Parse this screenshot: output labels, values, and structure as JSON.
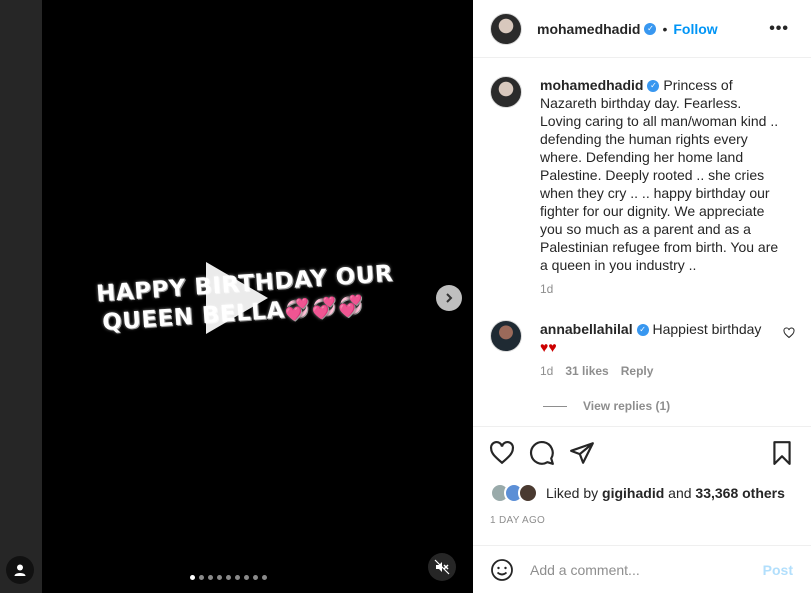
{
  "post": {
    "author": "mohamedhadid",
    "follow_label": "Follow",
    "separator": "•",
    "more_label": "•••",
    "video_overlay": {
      "line1": "HAPPY BIRTHDAY OUR",
      "line2": "QUEEN BELLA",
      "hearts": "💞💞💞"
    },
    "carousel": {
      "total": 9,
      "active_index": 0
    }
  },
  "caption": {
    "username": "mohamedhadid",
    "text": "Princess of Nazareth birthday day. Fearless. Loving caring to all man/woman kind .. defending the human rights every where. Defending her home land Palestine. Deeply rooted .. she cries when they cry .. .. happy birthday our fighter for our dignity. We appreciate you so much as a parent and as a Palestinian refugee from birth. You are a queen in you industry ..",
    "time": "1d"
  },
  "comment": {
    "username": "annabellahilal",
    "text": "Happiest birthday",
    "hearts": "♥♥",
    "time": "1d",
    "likes": "31 likes",
    "reply_label": "Reply",
    "view_replies": "View replies (1)"
  },
  "likes": {
    "prefix": "Liked by",
    "user": "gigihadid",
    "middle": "and",
    "others": "33,368 others"
  },
  "date": "1 DAY AGO",
  "add_comment": {
    "placeholder": "Add a comment...",
    "post_label": "Post"
  },
  "colors": {
    "link_blue": "#0095f6",
    "verified_blue": "#3897f0",
    "post_disabled": "#b2dffc"
  }
}
